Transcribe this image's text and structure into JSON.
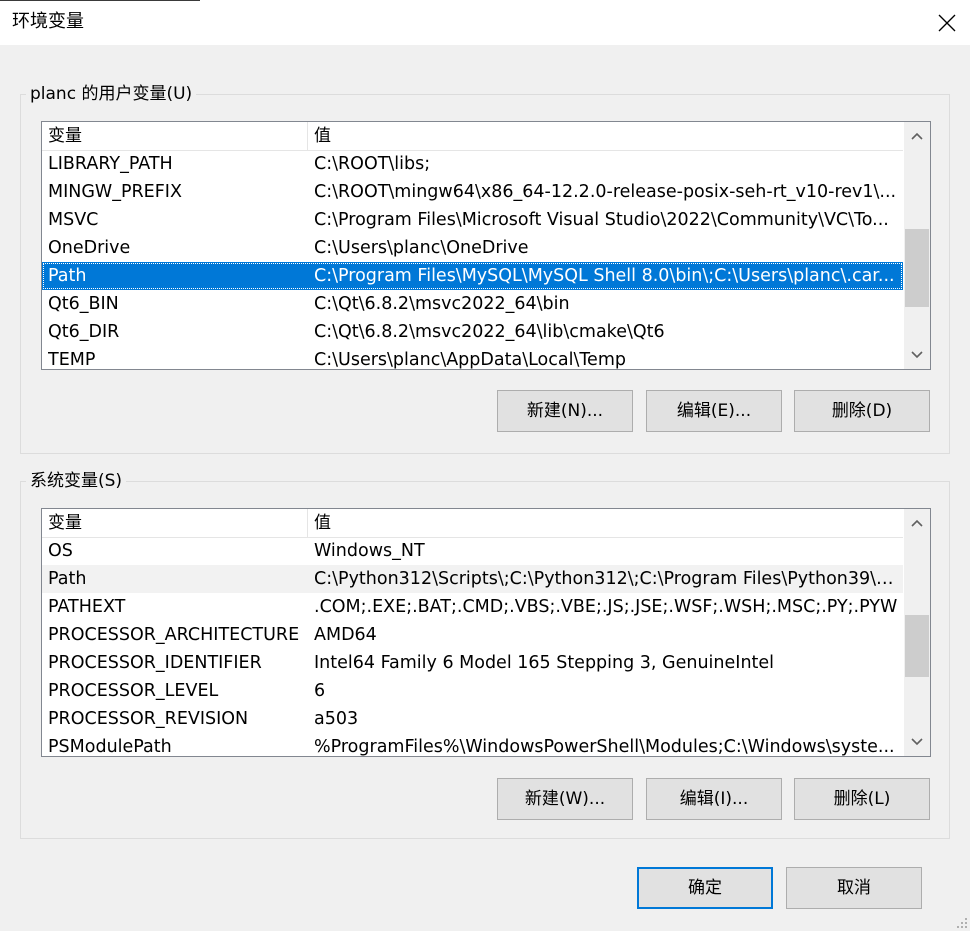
{
  "window": {
    "title": "环境变量"
  },
  "user_vars": {
    "group_label": "planc 的用户变量(U)",
    "columns": [
      "变量",
      "值"
    ],
    "rows": [
      {
        "name": "LIBRARY_PATH",
        "value": "C:\\ROOT\\libs;"
      },
      {
        "name": "MINGW_PREFIX",
        "value": "C:\\ROOT\\mingw64\\x86_64-12.2.0-release-posix-seh-rt_v10-rev1\\..."
      },
      {
        "name": "MSVC",
        "value": "C:\\Program Files\\Microsoft Visual Studio\\2022\\Community\\VC\\To..."
      },
      {
        "name": "OneDrive",
        "value": "C:\\Users\\planc\\OneDrive"
      },
      {
        "name": "Path",
        "value": "C:\\Program Files\\MySQL\\MySQL Shell 8.0\\bin\\;C:\\Users\\planc\\.car..."
      },
      {
        "name": "Qt6_BIN",
        "value": "C:\\Qt\\6.8.2\\msvc2022_64\\bin"
      },
      {
        "name": "Qt6_DIR",
        "value": "C:\\Qt\\6.8.2\\msvc2022_64\\lib\\cmake\\Qt6"
      },
      {
        "name": "TEMP",
        "value": "C:\\Users\\planc\\AppData\\Local\\Temp"
      }
    ],
    "selected_index": 4,
    "buttons": {
      "new": "新建(N)...",
      "edit": "编辑(E)...",
      "delete": "删除(D)"
    }
  },
  "system_vars": {
    "group_label": "系统变量(S)",
    "columns": [
      "变量",
      "值"
    ],
    "rows": [
      {
        "name": "OS",
        "value": "Windows_NT"
      },
      {
        "name": "Path",
        "value": "C:\\Python312\\Scripts\\;C:\\Python312\\;C:\\Program Files\\Python39\\S..."
      },
      {
        "name": "PATHEXT",
        "value": ".COM;.EXE;.BAT;.CMD;.VBS;.VBE;.JS;.JSE;.WSF;.WSH;.MSC;.PY;.PYW"
      },
      {
        "name": "PROCESSOR_ARCHITECTURE",
        "value": "AMD64"
      },
      {
        "name": "PROCESSOR_IDENTIFIER",
        "value": "Intel64 Family 6 Model 165 Stepping 3, GenuineIntel"
      },
      {
        "name": "PROCESSOR_LEVEL",
        "value": "6"
      },
      {
        "name": "PROCESSOR_REVISION",
        "value": "a503"
      },
      {
        "name": "PSModulePath",
        "value": "%ProgramFiles%\\WindowsPowerShell\\Modules;C:\\Windows\\syste..."
      }
    ],
    "hover_index": 1,
    "buttons": {
      "new": "新建(W)...",
      "edit": "编辑(I)...",
      "delete": "删除(L)"
    }
  },
  "footer": {
    "ok": "确定",
    "cancel": "取消"
  },
  "colors": {
    "selection": "#0078d7",
    "default_button_border": "#0078d7"
  }
}
